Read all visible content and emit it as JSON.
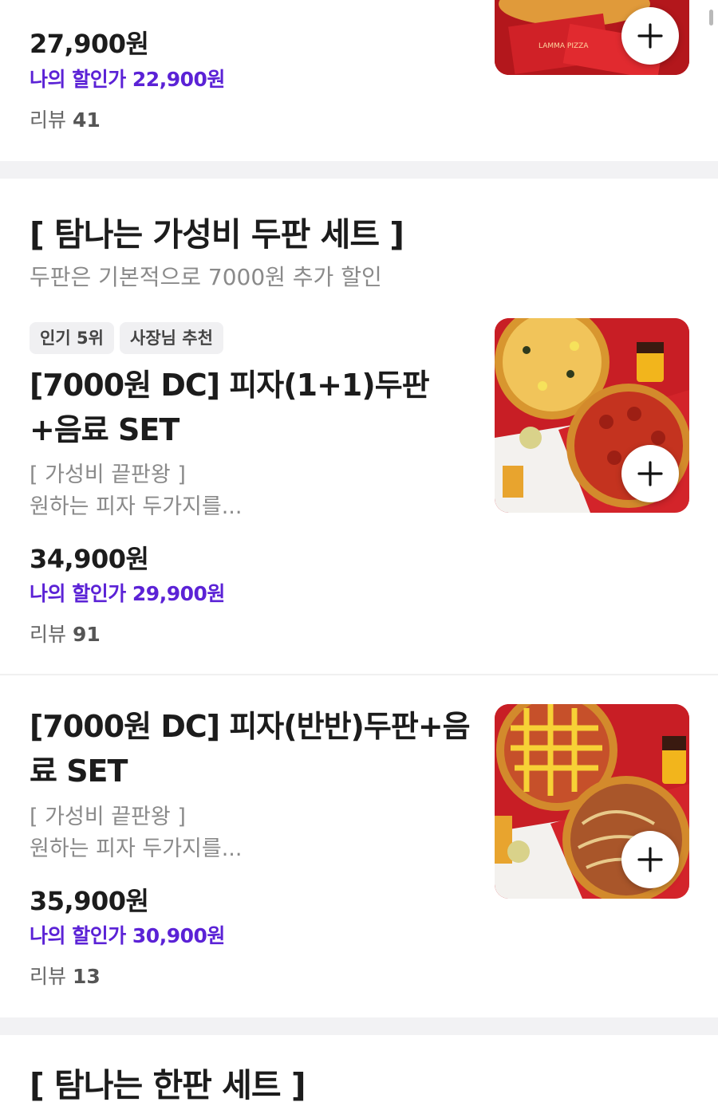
{
  "top_item": {
    "price": "27,900원",
    "discount": "나의 할인가 22,900원",
    "review_label": "리뷰",
    "review_count": "41"
  },
  "section": {
    "title": "[ 탐나는 가성비 두판 세트 ]",
    "description": "두판은 기본적으로 7000원 추가 할인"
  },
  "items": [
    {
      "badges": [
        "인기 5위",
        "사장님 추천"
      ],
      "title": "[7000원 DC] 피자(1+1)두판+음료 SET",
      "desc_line1": "[ 가성비 끝판왕 ]",
      "desc_line2": "원하는 피자 두가지를...",
      "price": "34,900원",
      "discount": "나의 할인가 29,900원",
      "review_label": "리뷰",
      "review_count": "91"
    },
    {
      "title": "[7000원 DC] 피자(반반)두판+음료 SET",
      "desc_line1": "[ 가성비 끝판왕 ]",
      "desc_line2": "원하는 피자 두가지를...",
      "price": "35,900원",
      "discount": "나의 할인가 30,900원",
      "review_label": "리뷰",
      "review_count": "13"
    }
  ],
  "next_section": {
    "title": "[ 탐나는 한판 세트 ]"
  },
  "colors": {
    "discount": "#5b22d6",
    "divider": "#f2f2f4",
    "thumb_red": "#c91f26"
  },
  "icons": {
    "add": "plus-icon"
  }
}
